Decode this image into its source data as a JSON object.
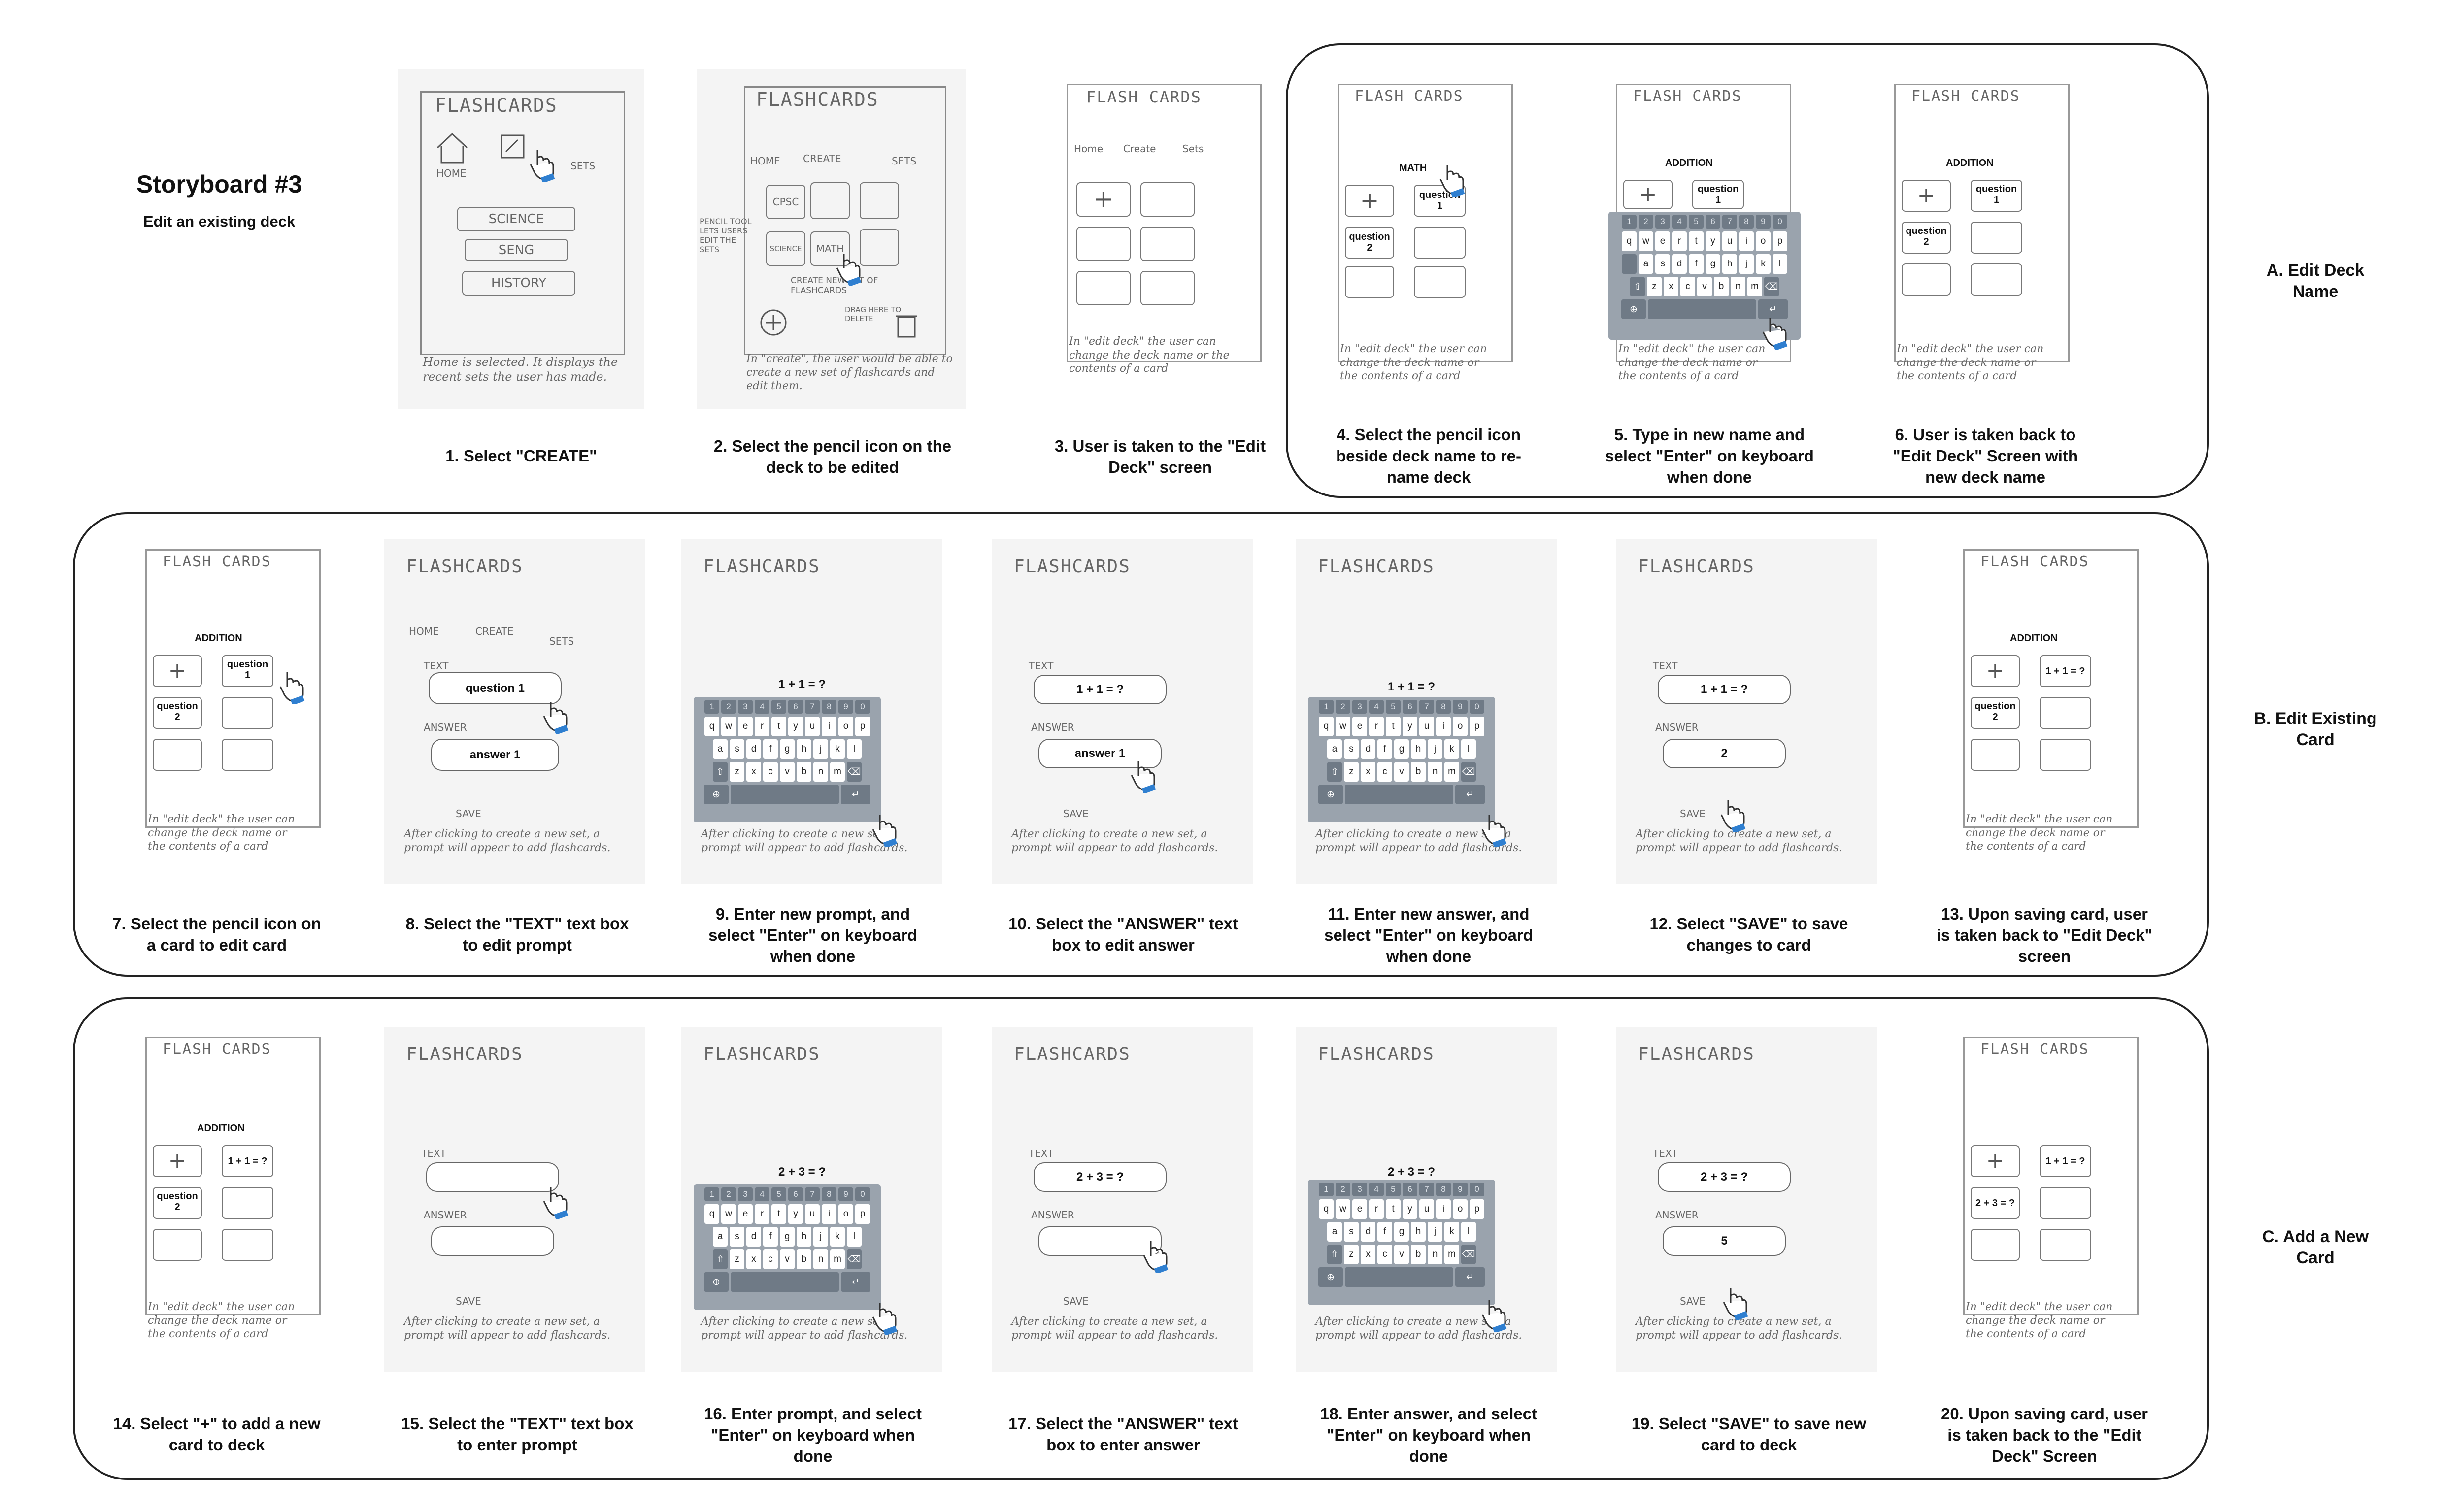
{
  "header": {
    "title": "Storyboard #3",
    "subtitle": "Edit an existing deck"
  },
  "sections": [
    {
      "label": "A. Edit Deck\nName"
    },
    {
      "label": "B. Edit Existing\nCard"
    },
    {
      "label": "C. Add a New\nCard"
    }
  ],
  "sketch_text": {
    "flashcards": "FLASHCARDS",
    "flash_cards": "FLASH CARDS",
    "home": "HOME",
    "create": "CREATE",
    "sets": "SETS",
    "home_lc": "Home",
    "create_lc": "Create",
    "sets_lc": "Sets",
    "science": "SCIENCE",
    "seng": "SENG",
    "history": "HISTORY",
    "home_note": "Home is selected. It displays the recent sets the user has made.",
    "create_note": "In \"create\", the user would be able to create a new set of flashcards and edit them.",
    "pencil_note": "PENCIL TOOL LETS USERS EDIT THE SETS",
    "cpsc": "CPSC",
    "math_deck": "MATH",
    "create_new": "CREATE NEW SET OF FLASHCARDS",
    "drag_delete": "DRAG HERE TO DELETE",
    "edit_deck_note": "In \"edit deck\" the user can change the deck name or the contents of a card",
    "prompt_note": "After clicking to create a new set, a prompt will appear to add flashcards.",
    "deck_math": "MATH",
    "deck_addition": "ADDITION",
    "q1": "question\n1",
    "q2": "question\n2",
    "text_label": "TEXT",
    "answer_label": "ANSWER",
    "save": "SAVE",
    "question_1": "question 1",
    "answer_1": "answer 1",
    "p_1p1": "1 + 1 = ?",
    "a_2": "2",
    "p_2p3": "2 + 3 = ?",
    "a_5": "5",
    "card_1p1": "1 + 1 = ?",
    "card_2p3": "2 + 3 = ?"
  },
  "keyboard": {
    "numbers": [
      "1",
      "2",
      "3",
      "4",
      "5",
      "6",
      "7",
      "8",
      "9",
      "0"
    ],
    "row1": [
      "q",
      "w",
      "e",
      "r",
      "t",
      "y",
      "u",
      "i",
      "o",
      "p"
    ],
    "row2": [
      "a",
      "s",
      "d",
      "f",
      "g",
      "h",
      "j",
      "k",
      "l"
    ],
    "row3": [
      "z",
      "x",
      "c",
      "v",
      "b",
      "n",
      "m"
    ]
  },
  "captions": {
    "c1": "1. Select \"CREATE\"",
    "c2": "2. Select the pencil icon on the\ndeck to be edited",
    "c3": "3. User is taken to the \"Edit\nDeck\" screen",
    "c4": "4. Select the pencil icon\nbeside deck name to re-\nname deck",
    "c5": "5. Type in new name and\nselect \"Enter\" on keyboard\nwhen done",
    "c6": "6. User is taken back to\n\"Edit Deck\" Screen with\nnew deck name",
    "c7": "7. Select the pencil icon on\na card to edit card",
    "c8": "8. Select the \"TEXT\" text box\nto edit prompt",
    "c9": "9. Enter new prompt, and\nselect \"Enter\" on keyboard\nwhen done",
    "c10": "10. Select the \"ANSWER\" text\nbox to edit answer",
    "c11": "11. Enter new answer, and\nselect \"Enter\" on keyboard\nwhen done",
    "c12": "12. Select \"SAVE\" to save\nchanges to card",
    "c13": "13. Upon saving card, user\nis taken back to \"Edit Deck\"\nscreen",
    "c14": "14. Select \"+\" to add a new\ncard to deck",
    "c15": "15. Select the \"TEXT\" text box\nto enter prompt",
    "c16": "16. Enter prompt, and select\n\"Enter\" on keyboard when\ndone",
    "c17": "17. Select the \"ANSWER\" text\nbox to enter answer",
    "c18": "18. Enter answer, and select\n\"Enter\" on keyboard when\ndone",
    "c19": "19. Select \"SAVE\" to save new\ncard to deck",
    "c20": "20. Upon saving card, user\nis taken back to the \"Edit\nDeck\" Screen"
  },
  "colors": {
    "hand_cuff": "#2f7fd0",
    "keyboard_bg": "#9aa3ad",
    "border": "#222222"
  }
}
